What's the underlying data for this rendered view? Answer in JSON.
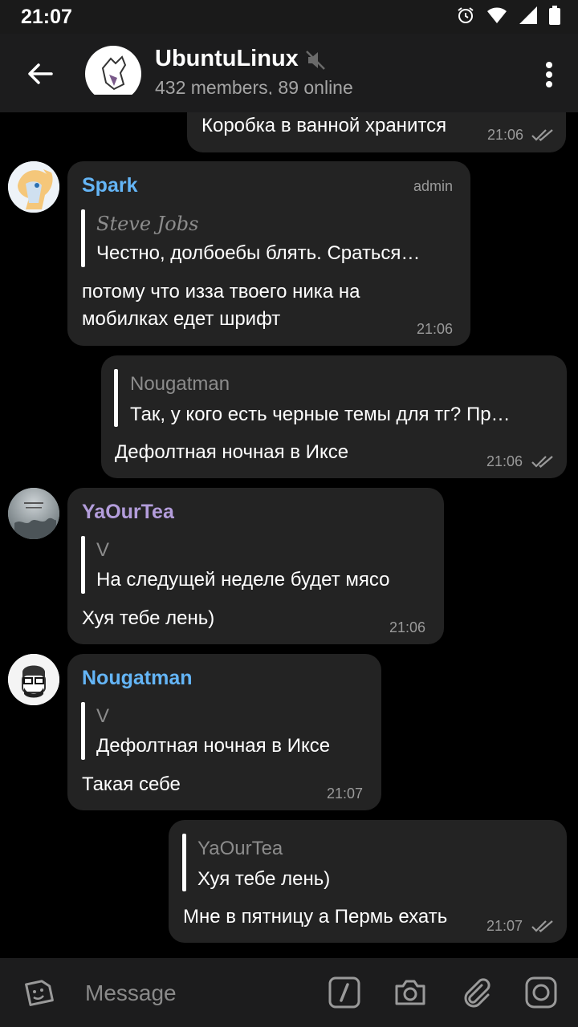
{
  "status": {
    "time": "21:07"
  },
  "header": {
    "title": "UbuntuLinux",
    "subtitle": "432 members, 89 online"
  },
  "messages": [
    {
      "id": "m0",
      "outgoing": true,
      "text": "Коробка в ванной хранится",
      "time": "21:06",
      "read": true
    },
    {
      "id": "m1",
      "outgoing": false,
      "sender": "Spark",
      "sender_color": "#64b5f6",
      "badge": "admin",
      "reply": {
        "name": "Steve Jobs",
        "text": "Честно, долбоебы блять. Сраться…"
      },
      "text_lines": [
        "потому что изза твоего ника на",
        "мобилках едет шрифт"
      ],
      "time": "21:06"
    },
    {
      "id": "m2",
      "outgoing": true,
      "reply": {
        "name": "Nougatman",
        "text": "Так, у кого есть черные темы для тг? Пр…"
      },
      "text": "Дефолтная ночная в Иксе",
      "time": "21:06",
      "read": true
    },
    {
      "id": "m3",
      "outgoing": false,
      "sender": "YaOurTea",
      "sender_color": "#b39ddb",
      "reply": {
        "name": "V",
        "text": "На следущей неделе будет мясо"
      },
      "text": "Хуя тебе лень)",
      "time": "21:06"
    },
    {
      "id": "m4",
      "outgoing": false,
      "sender": "Nougatman",
      "sender_color": "#64b5f6",
      "reply": {
        "name": "V",
        "text": "Дефолтная ночная в Иксе"
      },
      "text": "Такая себе",
      "time": "21:07"
    },
    {
      "id": "m5",
      "outgoing": true,
      "reply": {
        "name": "YaOurTea",
        "text": "Хуя тебе лень)"
      },
      "text": "Мне в пятницу а Пермь ехать",
      "time": "21:07",
      "read": true
    }
  ],
  "input": {
    "placeholder": "Message"
  },
  "icons": [
    "back-arrow-icon",
    "mute-icon",
    "more-vert-icon",
    "sticker-icon",
    "bot-command-icon",
    "camera-icon",
    "attach-icon",
    "instagram-camera-icon",
    "alarm-icon",
    "wifi-icon",
    "signal-icon",
    "battery-icon"
  ]
}
